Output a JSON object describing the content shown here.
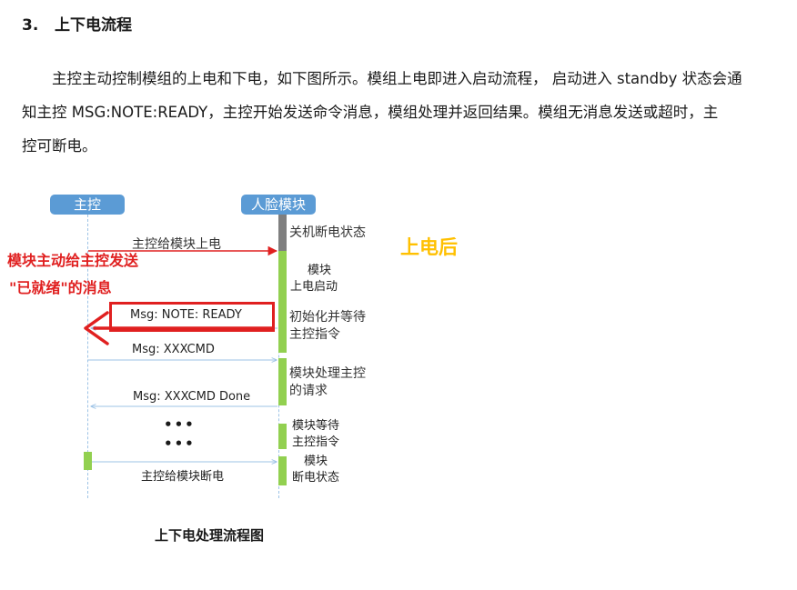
{
  "section": {
    "number": "3.",
    "title": "上下电流程"
  },
  "paragraph": {
    "line1": "主控主动控制模组的上电和下电，如下图所示。模组上电即进入启动流程， 启动进入 standby 状态会通",
    "line2": "知主控 MSG:NOTE:READY，主控开始发送命令消息，模组处理并返回结果。模组无消息发送或超时，主",
    "line3": "控可断电。"
  },
  "diagram": {
    "lifelines": {
      "left": "主控",
      "right": "人脸模块"
    },
    "messages": {
      "power_on": "主控给模块上电",
      "ready": "Msg: NOTE: READY",
      "cmd": "Msg: XXXCMD",
      "cmd_done": "Msg: XXXCMD Done",
      "power_off": "主控给模块断电"
    },
    "notes": {
      "off_state": "关机断电状态",
      "boot_1": "模块",
      "boot_2": "上电启动",
      "init_1": "初始化并等待",
      "init_2": "主控指令",
      "process_1": "模块处理主控",
      "process_2": "的请求",
      "wait_1": "模块等待",
      "wait_2": "主控指令",
      "off_1": "模块",
      "off_2": "断电状态"
    },
    "ellipsis_1": "•••",
    "ellipsis_2": "•••",
    "annotations": {
      "red_line1": "模块主动给主控发送",
      "red_line2": "\"已就绪\"的消息",
      "after_power_on": "上电后"
    },
    "colors": {
      "lifeline": "#5b9bd5",
      "active_bar": "#92d050",
      "off_bar": "#7f7f7f",
      "highlight": "#e02020",
      "annotation": "#ffc000"
    }
  },
  "caption": "上下电处理流程图"
}
